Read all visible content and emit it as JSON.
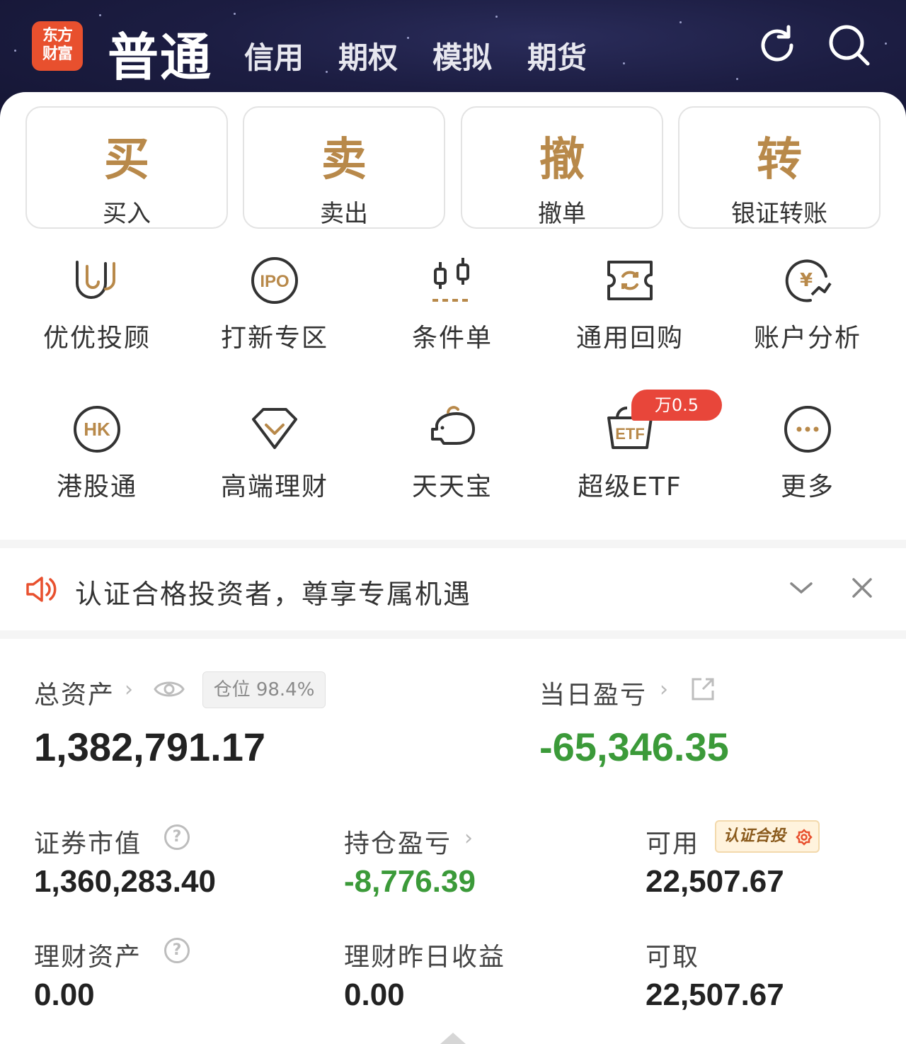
{
  "header": {
    "logo_line1": "东方",
    "logo_line2": "财富",
    "active_tab": "普通",
    "tabs": [
      "信用",
      "期权",
      "模拟",
      "期货"
    ]
  },
  "actions": [
    {
      "glyph": "买",
      "label": "买入"
    },
    {
      "glyph": "卖",
      "label": "卖出"
    },
    {
      "glyph": "撤",
      "label": "撤单"
    },
    {
      "glyph": "转",
      "label": "银证转账"
    }
  ],
  "grid": [
    {
      "label": "优优投顾",
      "icon": "u-icon"
    },
    {
      "label": "打新专区",
      "icon": "ipo-icon"
    },
    {
      "label": "条件单",
      "icon": "candlestick-icon"
    },
    {
      "label": "通用回购",
      "icon": "repurchase-icon"
    },
    {
      "label": "账户分析",
      "icon": "yen-chart-icon"
    },
    {
      "label": "港股通",
      "icon": "hk-icon"
    },
    {
      "label": "高端理财",
      "icon": "diamond-icon"
    },
    {
      "label": "天天宝",
      "icon": "piggy-icon"
    },
    {
      "label": "超级ETF",
      "icon": "etf-icon",
      "badge": "万0.5"
    },
    {
      "label": "更多",
      "icon": "more-icon"
    }
  ],
  "notice": {
    "text": "认证合格投资者，尊享专属机遇"
  },
  "assets": {
    "total_label": "总资产",
    "position_badge": "仓位 98.4%",
    "total_value": "1,382,791.17",
    "daily_pl_label": "当日盈亏",
    "daily_pl_value": "-65,346.35",
    "securities_label": "证券市值",
    "securities_value": "1,360,283.40",
    "holding_pl_label": "持仓盈亏",
    "holding_pl_value": "-8,776.39",
    "available_label": "可用",
    "cert_badge": "认证合投",
    "available_value": "22,507.67",
    "wealth_label": "理财资产",
    "wealth_value": "0.00",
    "wealth_yday_label": "理财昨日收益",
    "wealth_yday_value": "0.00",
    "withdraw_label": "可取",
    "withdraw_value": "22,507.67"
  },
  "colors": {
    "accent_gold": "#b8894a",
    "negative": "#3b9a39",
    "logo": "#e8502e",
    "badge_red": "#e8463a"
  }
}
